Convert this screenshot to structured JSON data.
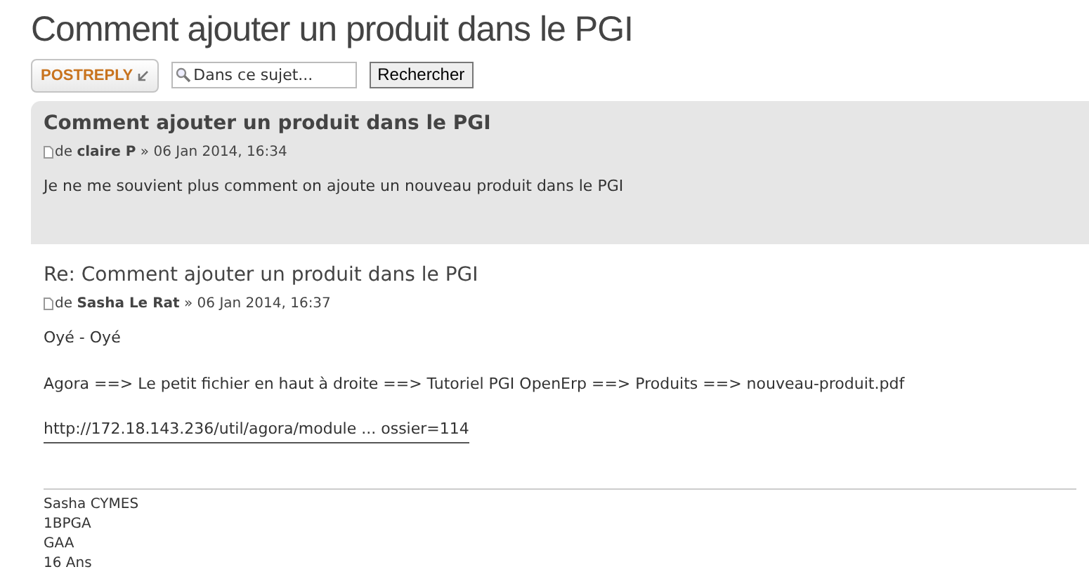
{
  "page_title": "Comment ajouter un produit dans le PGI",
  "toolbar": {
    "reply_button": "POSTREPLY",
    "search": {
      "placeholder": "Dans ce sujet..."
    },
    "search_button": "Rechercher"
  },
  "posts": [
    {
      "kind": "topic",
      "title": "Comment ajouter un produit dans le PGI",
      "byline": "de **claire P** » 06 Jan 2014, 16:34",
      "content": [
        {
          "kind": "text",
          "text": "Je ne me souvient plus comment on ajoute un nouveau produit dans le PGI"
        }
      ]
    },
    {
      "kind": "reply",
      "title": "Re: Comment ajouter un produit dans le PGI",
      "byline": "de **Sasha Le Rat** » 06 Jan 2014, 16:37",
      "content": [
        {
          "kind": "text",
          "text": "Oyé - Oyé"
        },
        {
          "kind": "text",
          "text": "Agora ==> Le petit fichier en haut à droite ==> Tutoriel PGI OpenErp ==> Produits ==> nouveau-produit.pdf"
        },
        {
          "kind": "link",
          "text": "http://172.18.143.236/util/agora/module ... ossier=114"
        }
      ],
      "signature": [
        "Sasha CYMES",
        "1BPGA",
        "GAA",
        "16 Ans"
      ]
    }
  ]
}
